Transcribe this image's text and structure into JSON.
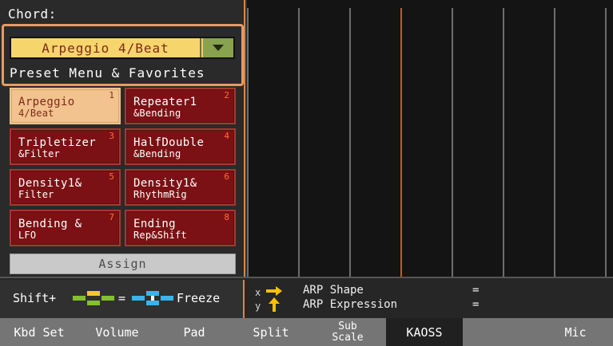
{
  "panel": {
    "chord_label": "Chord:",
    "preset_value": "Arpeggio 4/Beat",
    "preset_menu_label": "Preset Menu & Favorites",
    "assign_label": "Assign"
  },
  "presets": [
    {
      "num": "1",
      "line1": "Arpeggio",
      "line2": "4/Beat",
      "selected": true
    },
    {
      "num": "2",
      "line1": "Repeater1",
      "line2": "&Bending",
      "selected": false
    },
    {
      "num": "3",
      "line1": "Tripletizer",
      "line2": "&Filter",
      "selected": false
    },
    {
      "num": "4",
      "line1": "HalfDouble",
      "line2": "&Bending",
      "selected": false
    },
    {
      "num": "5",
      "line1": "Density1&",
      "line2": "Filter",
      "selected": false
    },
    {
      "num": "6",
      "line1": "Density1&",
      "line2": "RhythmRig",
      "selected": false
    },
    {
      "num": "7",
      "line1": "Bending &",
      "line2": "LFO",
      "selected": false
    },
    {
      "num": "8",
      "line1": "Ending",
      "line2": "Rep&Shift",
      "selected": false
    }
  ],
  "footer": {
    "shift_label": "Shift+",
    "equals": "=",
    "freeze_label": "Freeze",
    "x_key": "x",
    "y_key": "y",
    "arp_shape": "ARP Shape",
    "arp_expression": "ARP Expression",
    "arp_eq1": "=",
    "arp_eq2": "="
  },
  "tabs": [
    "Kbd Set",
    "Volume",
    "Pad",
    "Split",
    "Sub\nScale",
    "KAOSS",
    "",
    "Mic"
  ],
  "colors": {
    "accent": "#e69b65",
    "selected_preset": "#f2c28f",
    "preset_bg": "#7b1114",
    "kaoss_orange": "#cc5a17"
  },
  "icons": {
    "x_arrow": "arrow-right-icon",
    "y_arrow": "arrow-up-icon",
    "pad_left": "pad-icon",
    "pad_right": "pad-icon"
  }
}
